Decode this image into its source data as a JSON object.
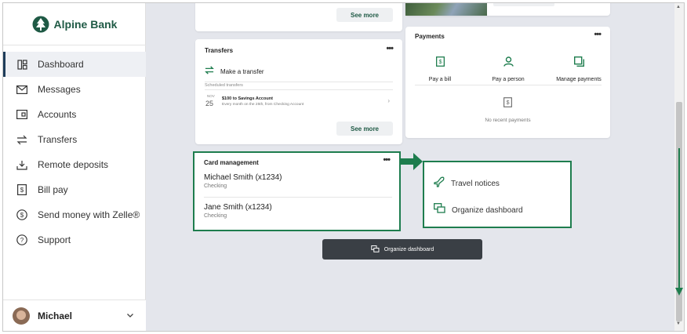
{
  "brand": {
    "name": "Alpine Bank",
    "color": "#1f5a45"
  },
  "sidebar": {
    "items": [
      {
        "label": "Dashboard",
        "icon": "dashboard-icon",
        "active": true
      },
      {
        "label": "Messages",
        "icon": "envelope-icon"
      },
      {
        "label": "Accounts",
        "icon": "accounts-icon"
      },
      {
        "label": "Transfers",
        "icon": "transfer-arrows-icon"
      },
      {
        "label": "Remote deposits",
        "icon": "deposit-icon"
      },
      {
        "label": "Bill pay",
        "icon": "bill-icon"
      },
      {
        "label": "Send money with Zelle®",
        "icon": "dollar-circle-icon"
      },
      {
        "label": "Support",
        "icon": "help-icon"
      }
    ],
    "user": {
      "name": "Michael"
    }
  },
  "top_card": {
    "see_more": "See more"
  },
  "transfers": {
    "title": "Transfers",
    "make_transfer": "Make a transfer",
    "scheduled_label": "Scheduled transfers",
    "item": {
      "month": "NOV",
      "day": "25",
      "title": "$100 to Savings Account",
      "subtitle": "Every month on the 25th, from Checking Account"
    },
    "see_more": "See more"
  },
  "payments": {
    "title": "Payments",
    "actions": [
      {
        "label": "Pay a bill",
        "icon": "bill-icon"
      },
      {
        "label": "Pay a person",
        "icon": "person-icon"
      },
      {
        "label": "Manage payments",
        "icon": "manage-icon"
      }
    ],
    "empty": "No recent payments"
  },
  "card_management": {
    "title": "Card management",
    "cards": [
      {
        "name": "Michael Smith (x1234)",
        "type": "Checking"
      },
      {
        "name": "Jane Smith (x1234)",
        "type": "Checking"
      }
    ]
  },
  "menu_popup": {
    "items": [
      {
        "label": "Travel notices",
        "icon": "airplane-icon"
      },
      {
        "label": "Organize dashboard",
        "icon": "organize-icon"
      }
    ]
  },
  "organize_button": {
    "label": "Organize dashboard"
  },
  "colors": {
    "accent": "#1e7d4e",
    "dark_button": "#3a3f45",
    "page_bg": "#e4e6ec"
  }
}
